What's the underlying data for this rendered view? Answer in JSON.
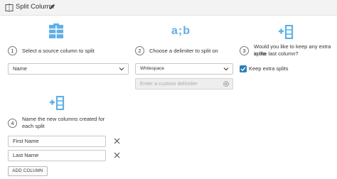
{
  "header": {
    "title": "Split Column",
    "icon": "split-column-icon",
    "edit_icon": "pencil-icon"
  },
  "colors": {
    "accent": "#5fb0e4",
    "checkbox": "#2c7fb8"
  },
  "steps": {
    "source": {
      "number": "1",
      "label": "Select a source column to split",
      "icon": "table-column-icon",
      "selected": "Name"
    },
    "delimiter": {
      "number": "2",
      "label": "Choose a delimiter to split on",
      "icon_text": "a;b",
      "selected": "Whitespace",
      "custom_placeholder": "Enter a custom delimiter"
    },
    "extra": {
      "number": "3",
      "label_line1": "Would you like to keep any extra splits",
      "label_line2": "in the last column?",
      "icon": "add-column-icon",
      "checkbox_label": "Keep extra splits",
      "checked": true
    },
    "names": {
      "number": "4",
      "label_line1": "Name the new columns created for",
      "label_line2": "each split",
      "icon": "add-column-icon",
      "columns": [
        "First Name",
        "Last Name"
      ],
      "add_button": "ADD COLUMN"
    }
  }
}
